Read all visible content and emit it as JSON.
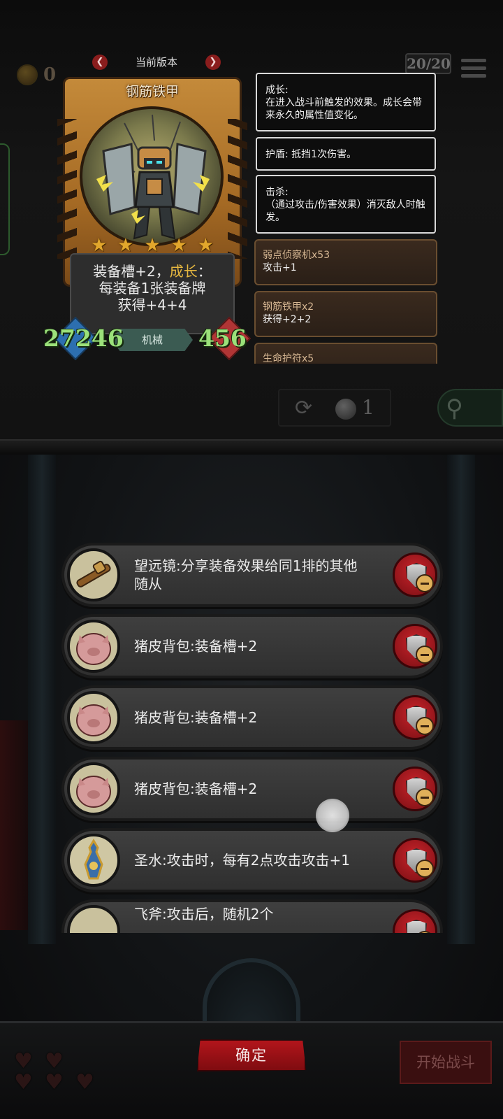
{
  "hud": {
    "coins": "0",
    "counter": "20/20"
  },
  "toolbar": {
    "refresh_tokens": "1"
  },
  "card": {
    "version_label": "当前版本",
    "name": "钢筋铁甲",
    "stars": [
      "★",
      "★",
      "★",
      "★",
      "★"
    ],
    "description": {
      "line1_prefix": "装备槽+2，",
      "line1_keyword": "成长",
      "line1_suffix": "：",
      "line2": "每装备1张装备牌",
      "line3": "获得+4+4"
    },
    "attack": "27246",
    "health": "456",
    "tribe": "机械",
    "colors": {
      "star": "#e2a72c",
      "stat": "#9be17a",
      "keyword": "#e6b840"
    }
  },
  "keywords": [
    {
      "title": "成长:",
      "text": "在进入战斗前触发的效果。成长会带来永久的属性值变化。"
    },
    {
      "title": "护盾: 抵挡1次伤害。",
      "text": ""
    },
    {
      "title": "击杀:",
      "text": "（通过攻击/伤害效果）消灭敌人时触发。"
    }
  ],
  "sources": [
    {
      "name": "弱点侦察机x53",
      "effect": "攻击+1"
    },
    {
      "name": "钢筋铁甲x2",
      "effect": "获得+2+2"
    },
    {
      "name": "生命护符x5",
      "effect": ""
    }
  ],
  "equipment": [
    {
      "icon": "telescope-icon",
      "text": "望远镜:分享装备效果给同1排的其他随从"
    },
    {
      "icon": "pig-backpack-icon",
      "text": "猪皮背包:装备槽+2"
    },
    {
      "icon": "pig-backpack-icon",
      "text": "猪皮背包:装备槽+2"
    },
    {
      "icon": "pig-backpack-icon",
      "text": "猪皮背包:装备槽+2"
    },
    {
      "icon": "holy-water-icon",
      "text": "圣水:攻击时，每有2点攻击攻击+1"
    },
    {
      "icon": "flying-axe-icon",
      "text": "飞斧:攻击后，随机2个"
    }
  ],
  "buttons": {
    "confirm": "确定",
    "start_battle": "开始战斗"
  },
  "lives": [
    "♥",
    "♥",
    "♥",
    "♥",
    "♥"
  ]
}
